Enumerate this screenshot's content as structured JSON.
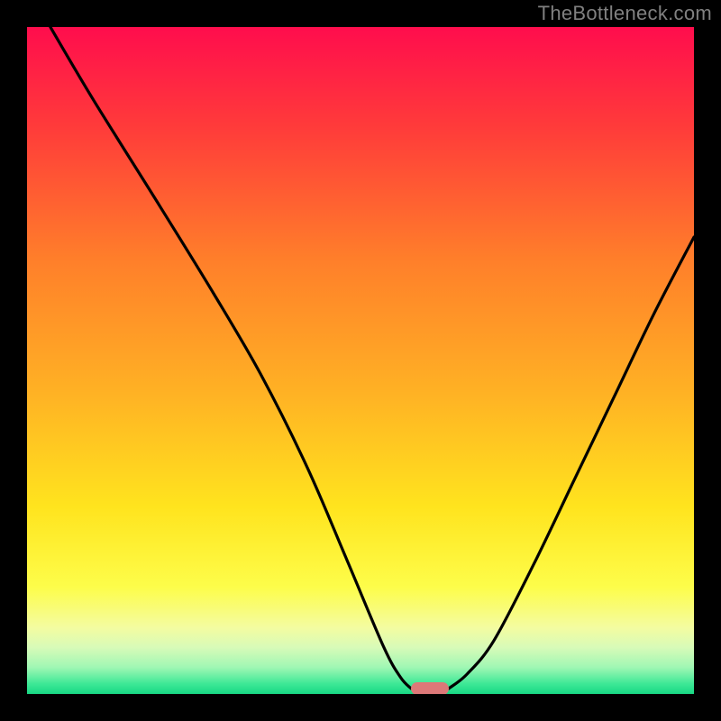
{
  "watermark": "TheBottleneck.com",
  "chart_data": {
    "type": "line",
    "title": "",
    "xlabel": "",
    "ylabel": "",
    "xlim": [
      0,
      100
    ],
    "ylim": [
      0,
      100
    ],
    "grid": false,
    "legend": false,
    "series": [
      {
        "name": "left-curve",
        "x": [
          3.5,
          10,
          20,
          28,
          35,
          42,
          48,
          53.5,
          56,
          57.6
        ],
        "y": [
          100,
          89,
          73,
          60,
          48,
          34,
          20,
          7,
          2.5,
          0.8
        ]
      },
      {
        "name": "right-curve",
        "x": [
          63.2,
          66,
          70,
          76,
          82,
          88,
          94,
          100
        ],
        "y": [
          0.8,
          3,
          8,
          19.5,
          32,
          44.5,
          57,
          68.5
        ]
      }
    ],
    "minimum_marker": {
      "x_center": 60.4,
      "width": 5.6,
      "y": 0.8
    },
    "gradient_stops": [
      {
        "offset": 0.0,
        "color": "#ff0d4d"
      },
      {
        "offset": 0.15,
        "color": "#ff3b3a"
      },
      {
        "offset": 0.35,
        "color": "#ff7f2a"
      },
      {
        "offset": 0.55,
        "color": "#ffb224"
      },
      {
        "offset": 0.72,
        "color": "#ffe41e"
      },
      {
        "offset": 0.84,
        "color": "#fdfd4a"
      },
      {
        "offset": 0.9,
        "color": "#f4fca0"
      },
      {
        "offset": 0.93,
        "color": "#d8fbb8"
      },
      {
        "offset": 0.96,
        "color": "#a0f7b4"
      },
      {
        "offset": 0.985,
        "color": "#3de896"
      },
      {
        "offset": 1.0,
        "color": "#18d884"
      }
    ]
  }
}
